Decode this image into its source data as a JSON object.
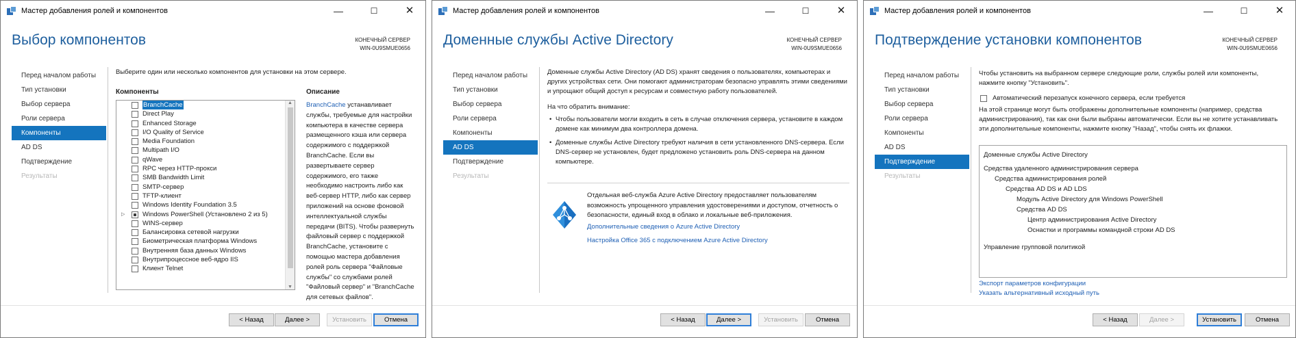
{
  "window_title": "Мастер добавления ролей и компонентов",
  "server_label": "КОНЕЧНЫЙ СЕРВЕР",
  "server_name": "WIN-0U9SMUE0656",
  "nav_items": [
    "Перед началом работы",
    "Тип установки",
    "Выбор сервера",
    "Роли сервера",
    "Компоненты",
    "AD DS",
    "Подтверждение",
    "Результаты"
  ],
  "buttons": {
    "back": "< Назад",
    "next": "Далее >",
    "install": "Установить",
    "cancel": "Отмена"
  },
  "colors": {
    "accent": "#1474be",
    "heading": "#1e5f9e",
    "link": "#1e5fb4"
  },
  "window1": {
    "heading": "Выбор компонентов",
    "intro": "Выберите один или несколько компонентов для установки на этом сервере.",
    "components_header": "Компоненты",
    "description_header": "Описание",
    "components": [
      {
        "label": "BranchCache",
        "state": "unchecked",
        "selected": true,
        "expandable": false
      },
      {
        "label": "Direct Play",
        "state": "unchecked",
        "selected": false,
        "expandable": false
      },
      {
        "label": "Enhanced Storage",
        "state": "unchecked",
        "selected": false,
        "expandable": false
      },
      {
        "label": "I/O Quality of Service",
        "state": "unchecked",
        "selected": false,
        "expandable": false
      },
      {
        "label": "Media Foundation",
        "state": "unchecked",
        "selected": false,
        "expandable": false
      },
      {
        "label": "Multipath I/O",
        "state": "unchecked",
        "selected": false,
        "expandable": false
      },
      {
        "label": "qWave",
        "state": "unchecked",
        "selected": false,
        "expandable": false
      },
      {
        "label": "RPC через HTTP-прокси",
        "state": "unchecked",
        "selected": false,
        "expandable": false
      },
      {
        "label": "SMB Bandwidth Limit",
        "state": "unchecked",
        "selected": false,
        "expandable": false
      },
      {
        "label": "SMTP-сервер",
        "state": "unchecked",
        "selected": false,
        "expandable": false
      },
      {
        "label": "TFTP-клиент",
        "state": "unchecked",
        "selected": false,
        "expandable": false
      },
      {
        "label": "Windows Identity Foundation 3.5",
        "state": "unchecked",
        "selected": false,
        "expandable": false
      },
      {
        "label": "Windows PowerShell (Установлено 2 из 5)",
        "state": "partial",
        "selected": false,
        "expandable": true
      },
      {
        "label": "WINS-сервер",
        "state": "unchecked",
        "selected": false,
        "expandable": false
      },
      {
        "label": "Балансировка сетевой нагрузки",
        "state": "unchecked",
        "selected": false,
        "expandable": false
      },
      {
        "label": "Биометрическая платформа Windows",
        "state": "unchecked",
        "selected": false,
        "expandable": false
      },
      {
        "label": "Внутренняя база данных Windows",
        "state": "unchecked",
        "selected": false,
        "expandable": false
      },
      {
        "label": "Внутрипроцессное веб-ядро IIS",
        "state": "unchecked",
        "selected": false,
        "expandable": false
      },
      {
        "label": "Клиент Telnet",
        "state": "unchecked",
        "selected": false,
        "expandable": false
      }
    ],
    "description_link": "BranchCache",
    "description_lines": [
      " устанавливает",
      "службы, требуемые для настройки",
      "компьютера в качестве сервера",
      "размещенного кэша или сервера",
      "содержимого с поддержкой",
      "BranchCache. Если вы",
      "развертываете сервер",
      "содержимого, его также",
      "необходимо настроить либо как",
      "веб-сервер HTTP, либо как сервер",
      "приложений на основе фоновой",
      "интеллектуальной службы",
      "передачи (BITS). Чтобы развернуть",
      "файловый сервер с поддержкой",
      "BranchCache, установите с",
      "помощью мастера добавления",
      "ролей роль сервера \"Файловые",
      "службы\" со службами ролей",
      "\"Файловый сервер\" и \"BranchCache",
      "для сетевых файлов\"."
    ]
  },
  "window2": {
    "heading": "Доменные службы Active Directory",
    "intro_lines": [
      "Доменные службы Active Directory (AD DS) хранят сведения о пользователях, компьютерах и",
      "других устройствах сети. Они помогают администраторам безопасно управлять этими сведениями",
      "и упрощают общий доступ к ресурсам и совместную работу пользователей."
    ],
    "attention_title": "На что обратить внимание:",
    "bullets": [
      [
        "Чтобы пользователи могли входить в сеть в случае отключения сервера, установите в каждом",
        "домене как минимум два контроллера домена."
      ],
      [
        "Доменные службы Active Directory требуют наличия в сети установленного DNS-сервера.  Если",
        "DNS-сервер не установлен, будет предложено установить роль DNS-сервера на данном",
        "компьютере."
      ]
    ],
    "azure_lines": [
      "Отдельная веб-служба Azure Active Directory предоставляет пользователям",
      "возможность упрощенного управления удостоверениями и доступом, отчетность о",
      "безопасности, единый вход в облако и локальные веб-приложения."
    ],
    "azure_link1": "Дополнительные сведения о Azure Active Directory",
    "azure_link2": "Настройка Office 365 с подключением Azure Active Directory"
  },
  "window3": {
    "heading": "Подтверждение установки компонентов",
    "intro_lines": [
      "Чтобы установить на выбранном сервере следующие роли, службы ролей или компоненты,",
      "нажмите кнопку \"Установить\"."
    ],
    "restart_label": "Автоматический перезапуск конечного сервера, если требуется",
    "note_lines": [
      "На этой странице могут быть отображены дополнительные компоненты (например, средства",
      "администрирования), так как они были выбраны автоматически. Если вы не хотите устанавливать",
      "эти дополнительные компоненты, нажмите кнопку \"Назад\", чтобы снять их флажки."
    ],
    "summary": [
      {
        "text": "Доменные службы Active Directory",
        "level": 0
      },
      {
        "text": "Средства удаленного администрирования сервера",
        "level": 0
      },
      {
        "text": "Средства администрирования ролей",
        "level": 1
      },
      {
        "text": "Средства AD DS и AD LDS",
        "level": 2
      },
      {
        "text": "Модуль Active Directory для Windows PowerShell",
        "level": 3
      },
      {
        "text": "Средства AD DS",
        "level": 3
      },
      {
        "text": "Центр администрирования Active Directory",
        "level": 4
      },
      {
        "text": "Оснастки и программы командной строки AD DS",
        "level": 4
      },
      {
        "text": "Управление групповой политикой",
        "level": 0
      }
    ],
    "link_export": "Экспорт параметров конфигурации",
    "link_source": "Указать альтернативный исходный путь"
  }
}
